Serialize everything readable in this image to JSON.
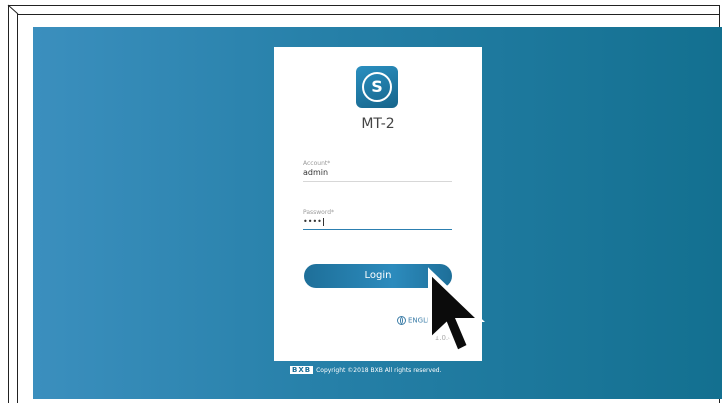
{
  "app": {
    "name": "MT-2",
    "icon": "s-logo-icon",
    "icon_letter": "S"
  },
  "form": {
    "account": {
      "label": "Account*",
      "value": "admin"
    },
    "password": {
      "label": "Password*",
      "value": "••••"
    },
    "login_label": "Login"
  },
  "language": {
    "label": "ENGLISH",
    "icon": "globe-icon"
  },
  "version": "V1.0.4",
  "footer": {
    "logo": "BXB",
    "copyright": "Copyright ©2018 BXB All rights reserved."
  },
  "colors": {
    "background_start": "#3b8fbe",
    "background_end": "#137090",
    "accent": "#1e6f99",
    "field_line_active": "#2c7fb0"
  }
}
